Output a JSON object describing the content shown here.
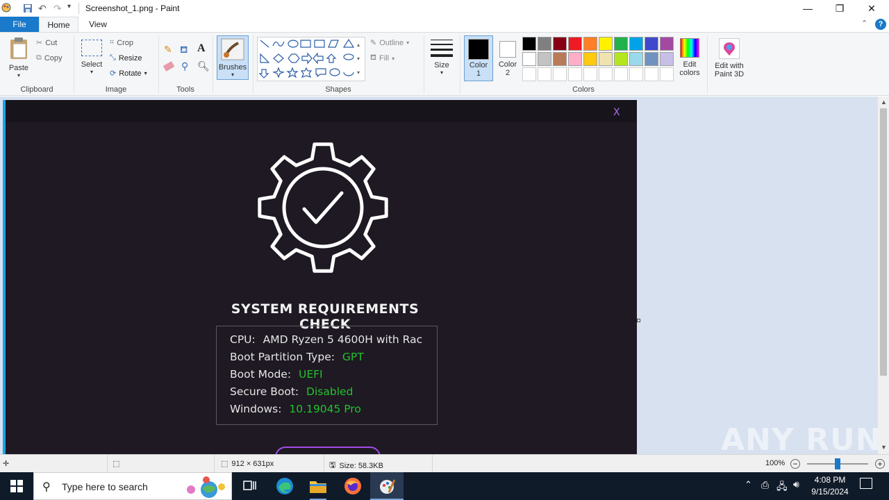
{
  "title": {
    "text": "Screenshot_1.png - Paint"
  },
  "menu": {
    "file": "File",
    "home": "Home",
    "view": "View"
  },
  "ribbon": {
    "clipboard": {
      "paste": "Paste",
      "cut": "Cut",
      "copy": "Copy",
      "label": "Clipboard"
    },
    "image": {
      "select": "Select",
      "crop": "Crop",
      "resize": "Resize",
      "rotate": "Rotate",
      "label": "Image"
    },
    "tools": {
      "label": "Tools"
    },
    "brushes": "Brushes",
    "shapes": {
      "outline": "Outline",
      "fill": "Fill",
      "label": "Shapes"
    },
    "size": "Size",
    "color1": [
      "Color",
      "1"
    ],
    "color2": [
      "Color",
      "2"
    ],
    "colors_label": "Colors",
    "edit_colors": [
      "Edit",
      "colors"
    ],
    "paint3d": [
      "Edit with",
      "Paint 3D"
    ]
  },
  "palette": {
    "row1": [
      "#000000",
      "#7f7f7f",
      "#880015",
      "#ed1c24",
      "#ff7f27",
      "#fff200",
      "#22b14c",
      "#00a2e8",
      "#3f48cc",
      "#a349a4"
    ],
    "row2": [
      "#ffffff",
      "#c3c3c3",
      "#b97a57",
      "#ffaec9",
      "#ffc90e",
      "#efe4b0",
      "#b5e61d",
      "#99d9ea",
      "#7092be",
      "#c8bfe7"
    ],
    "color1": "#000000",
    "color2": "#ffffff"
  },
  "dialog": {
    "close": "X",
    "heading": "SYSTEM REQUIREMENTS CHECK",
    "rows": [
      {
        "label": "CPU:",
        "value": "AMD Ryzen 5 4600H with Rac",
        "color": "#e6e6e6"
      },
      {
        "label": "Boot Partition Type:",
        "value": "GPT",
        "color": "#22c32e"
      },
      {
        "label": "Boot Mode:",
        "value": "UEFI",
        "color": "#22c32e"
      },
      {
        "label": "Secure Boot:",
        "value": "Disabled",
        "color": "#22c32e"
      },
      {
        "label": "Windows:",
        "value": "10.19045 Pro",
        "color": "#22c32e"
      }
    ]
  },
  "watermark": "ANY RUN",
  "status": {
    "dimensions": "912 × 631px",
    "size": "Size: 58.3KB",
    "zoom": "100%"
  },
  "taskbar": {
    "search_placeholder": "Type here to search",
    "time": "4:08 PM",
    "date": "9/15/2024"
  }
}
